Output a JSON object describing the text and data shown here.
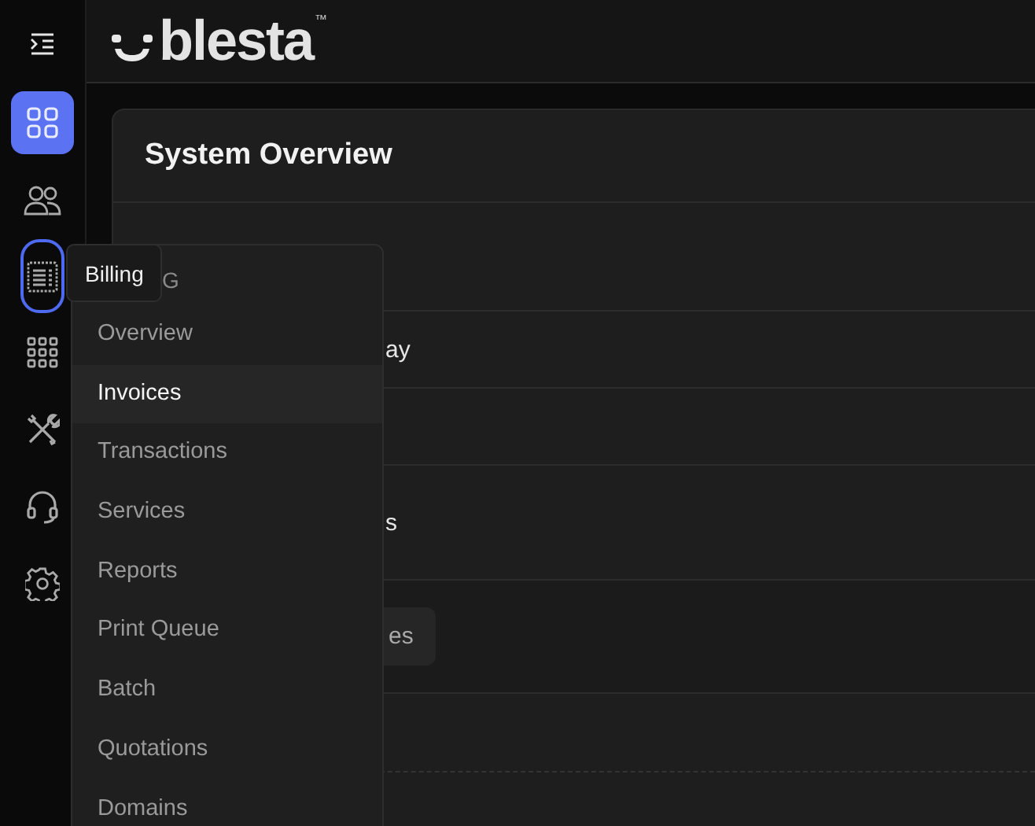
{
  "sidebar": {
    "items": [
      {
        "selected": true,
        "focused": false
      },
      {
        "selected": false,
        "focused": false
      },
      {
        "selected": false,
        "focused": true
      },
      {
        "selected": false,
        "focused": false
      },
      {
        "selected": false,
        "focused": false
      },
      {
        "selected": false,
        "focused": false
      },
      {
        "selected": false,
        "focused": false
      }
    ]
  },
  "header": {
    "logo": "blesta",
    "trademark": "™"
  },
  "card": {
    "title": "System Overview",
    "rows": [
      {
        "kind": "text",
        "text": "ay"
      },
      {
        "kind": "empty"
      },
      {
        "kind": "text",
        "text": "s"
      },
      {
        "kind": "button",
        "text": "es"
      },
      {
        "kind": "empty"
      }
    ]
  },
  "tooltip": "Billing",
  "menu": {
    "heading": "G",
    "items": [
      {
        "label": "Overview",
        "selected": false
      },
      {
        "label": "Invoices",
        "selected": true
      },
      {
        "label": "Transactions",
        "selected": false
      },
      {
        "label": "Services",
        "selected": false
      },
      {
        "label": "Reports",
        "selected": false
      },
      {
        "label": "Print Queue",
        "selected": false
      },
      {
        "label": "Batch",
        "selected": false
      },
      {
        "label": "Quotations",
        "selected": false
      },
      {
        "label": "Domains",
        "selected": false
      }
    ]
  }
}
